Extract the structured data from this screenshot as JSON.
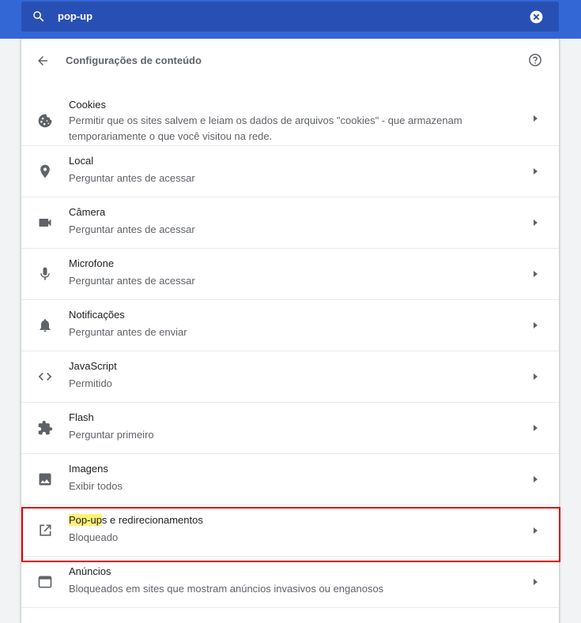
{
  "search": {
    "value": "pop-up"
  },
  "header": {
    "title": "Configurações de conteúdo"
  },
  "items": [
    {
      "title": "Cookies",
      "subtitle": "Permitir que os sites salvem e leiam os dados de arquivos \"cookies\" - que armazenam temporariamente o que você visitou na rede.",
      "icon": "cookie-icon"
    },
    {
      "title": "Local",
      "subtitle": "Perguntar antes de acessar",
      "icon": "location-pin-icon"
    },
    {
      "title": "Câmera",
      "subtitle": "Perguntar antes de acessar",
      "icon": "camera-icon"
    },
    {
      "title": "Microfone",
      "subtitle": "Perguntar antes de acessar",
      "icon": "microphone-icon"
    },
    {
      "title": "Notificações",
      "subtitle": "Perguntar antes de enviar",
      "icon": "bell-icon"
    },
    {
      "title": "JavaScript",
      "subtitle": "Permitido",
      "icon": "code-icon"
    },
    {
      "title": "Flash",
      "subtitle": "Perguntar primeiro",
      "icon": "puzzle-icon"
    },
    {
      "title": "Imagens",
      "subtitle": "Exibir todos",
      "icon": "image-icon"
    },
    {
      "title_highlight": "Pop-up",
      "title_rest": "s e redirecionamentos",
      "subtitle": "Bloqueado",
      "icon": "open-in-new-icon"
    },
    {
      "title": "Anúncios",
      "subtitle": "Bloqueados em sites que mostram anúncios invasivos ou enganosos",
      "icon": "ads-window-icon"
    }
  ],
  "colors": {
    "topbar": "#3367d6",
    "highlight": "#fff176",
    "highlight_border": "#e00000"
  }
}
